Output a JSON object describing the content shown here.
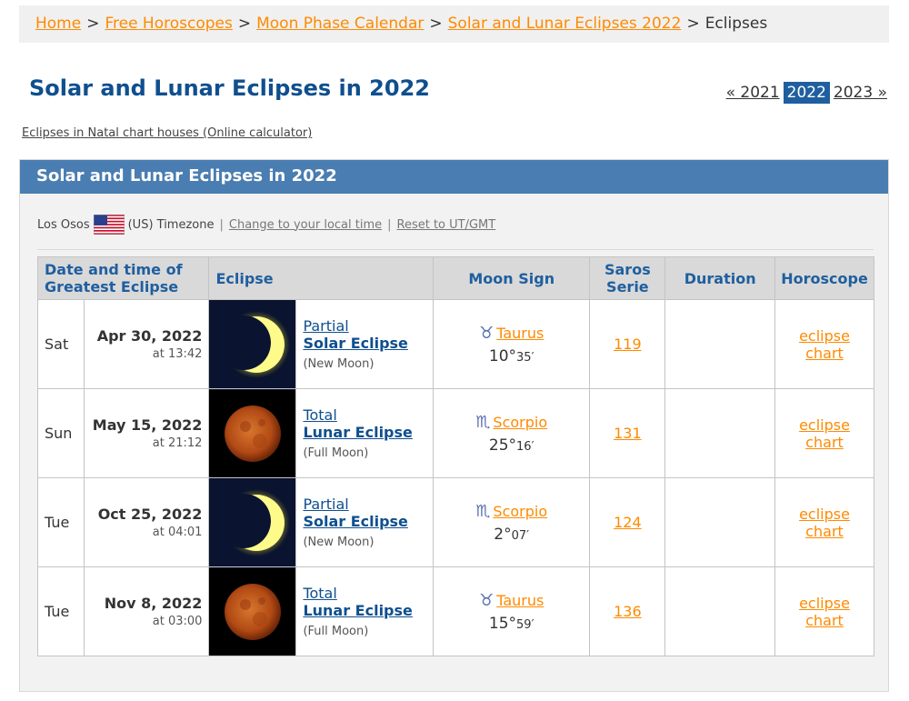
{
  "breadcrumb": {
    "items": [
      "Home",
      "Free Horoscopes",
      "Moon Phase Calendar",
      "Solar and Lunar Eclipses 2022"
    ],
    "current": "Eclipses",
    "separator": ">"
  },
  "page_title": "Solar and Lunar Eclipses in 2022",
  "year_nav": {
    "prev": "« 2021",
    "current": "2022",
    "next": "2023 »"
  },
  "natal_link": "Eclipses in Natal chart houses (Online calculator)",
  "panel": {
    "title": "Solar and Lunar Eclipses in 2022",
    "location": "Los Osos",
    "timezone_text": "(US) Timezone",
    "divider": "|",
    "change_local": "Change to your local time",
    "reset_utc": "Reset to UT/GMT"
  },
  "table": {
    "headers": {
      "datetime": "Date and time of Greatest Eclipse",
      "eclipse": "Eclipse",
      "moon_sign": "Moon Sign",
      "saros": "Saros Serie",
      "duration": "Duration",
      "horoscope": "Horoscope"
    },
    "rows": [
      {
        "day": "Sat",
        "date": "Apr 30, 2022",
        "time": "at 13:42",
        "kind": "Partial",
        "type": "Solar Eclipse",
        "phase": "(New Moon)",
        "glyph": "♉",
        "sign": "Taurus",
        "deg": "10°",
        "min": "35′",
        "saros": "119",
        "duration": "",
        "horo1": "eclipse",
        "horo2": "chart",
        "image": "solar-crescent"
      },
      {
        "day": "Sun",
        "date": "May 15, 2022",
        "time": "at 21:12",
        "kind": "Total",
        "type": "Lunar Eclipse",
        "phase": "(Full Moon)",
        "glyph": "♏",
        "sign": "Scorpio",
        "deg": "25°",
        "min": "16′",
        "saros": "131",
        "duration": "",
        "horo1": "eclipse",
        "horo2": "chart",
        "image": "blood-moon"
      },
      {
        "day": "Tue",
        "date": "Oct 25, 2022",
        "time": "at 04:01",
        "kind": "Partial",
        "type": "Solar Eclipse",
        "phase": "(New Moon)",
        "glyph": "♏",
        "sign": "Scorpio",
        "deg": "2°",
        "min": "07′",
        "saros": "124",
        "duration": "",
        "horo1": "eclipse",
        "horo2": "chart",
        "image": "solar-crescent"
      },
      {
        "day": "Tue",
        "date": "Nov 8, 2022",
        "time": "at 03:00",
        "kind": "Total",
        "type": "Lunar Eclipse",
        "phase": "(Full Moon)",
        "glyph": "♉",
        "sign": "Taurus",
        "deg": "15°",
        "min": "59′",
        "saros": "136",
        "duration": "",
        "horo1": "eclipse",
        "horo2": "chart",
        "image": "blood-moon"
      }
    ]
  },
  "colors": {
    "link_orange": "#ff8a00",
    "title_blue": "#0f4f8f",
    "panel_header": "#4a7db1",
    "year_current_bg": "#1f5f9f"
  }
}
